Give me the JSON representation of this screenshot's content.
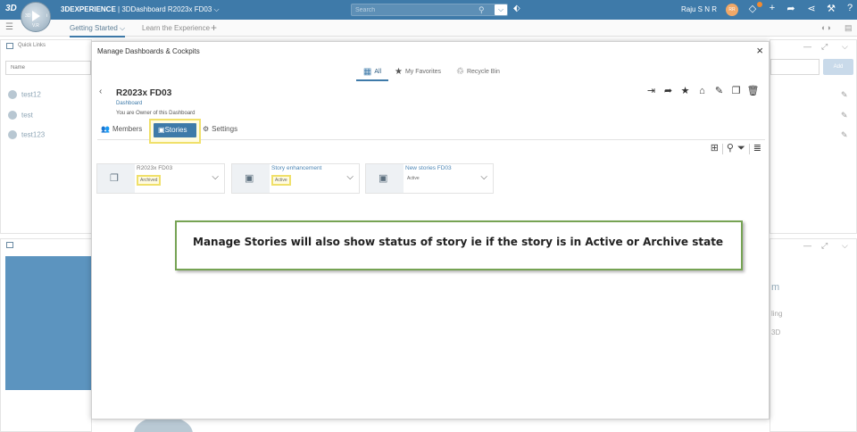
{
  "topbar": {
    "brand": "3D",
    "title_bold": "3DEXPERIENCE",
    "title_rest": " | 3DDashboard  R2023x FD03",
    "dropdown_glyph": "⌵",
    "search_placeholder": "Search",
    "user_name": "Raju S N R",
    "user_initials": "RR",
    "compass_bottom": "V.R",
    "compass_left": "3D",
    "compass_right": "i",
    "icons": [
      "compass-icon",
      "tag-icon",
      "share-icon",
      "plus-icon",
      "forward-icon",
      "network-icon",
      "tools-icon",
      "help-icon"
    ]
  },
  "tabs": {
    "items": [
      {
        "label": "Getting Started",
        "active": true
      },
      {
        "label": "Learn the Experience",
        "active": false
      }
    ],
    "chevron": "⌵",
    "add": "+"
  },
  "quick_links": {
    "title": "Quick Links",
    "name_placeholder": "Name",
    "add_label": "Add",
    "links": [
      "test12",
      "test",
      "test123"
    ]
  },
  "background_text": {
    "right_1": "m",
    "right_2": "ling",
    "right_3": "3D"
  },
  "modal": {
    "title": "Manage Dashboards & Cockpits",
    "close": "×",
    "filter_tabs": [
      {
        "label": "All",
        "icon": "grid-icon",
        "active": true
      },
      {
        "label": "My Favorites",
        "icon": "star-icon",
        "active": false
      },
      {
        "label": "Recycle Bin",
        "icon": "recycle-icon",
        "active": false
      }
    ],
    "dashboard": {
      "name": "R2023x FD03",
      "type": "Dashboard",
      "owner_note": "You are Owner of this Dashboard"
    },
    "action_icons": [
      "enter-icon",
      "share-icon",
      "favorite-icon",
      "home-icon",
      "edit-icon",
      "copy-icon",
      "delete-icon"
    ],
    "sub_tabs": {
      "members": "Members",
      "stories": "Stories",
      "settings": "Settings"
    },
    "tool_icons": [
      "add-story-icon",
      "search-icon",
      "filter-icon",
      "list-view-icon"
    ],
    "stories": [
      {
        "name": "R2023x FD03",
        "status": "Archived",
        "link": false
      },
      {
        "name": "Story enhancement",
        "status": "Active",
        "link": true
      },
      {
        "name": "New stories FD03",
        "status": "Active",
        "link": true
      }
    ],
    "callout": "Manage Stories will also show status of story ie if the story is in Active or Archive state"
  },
  "colors": {
    "topbar": "#3e7aa9",
    "accent": "#3e7aa9",
    "highlight": "#f0e06a",
    "callout_border": "#76a354"
  }
}
